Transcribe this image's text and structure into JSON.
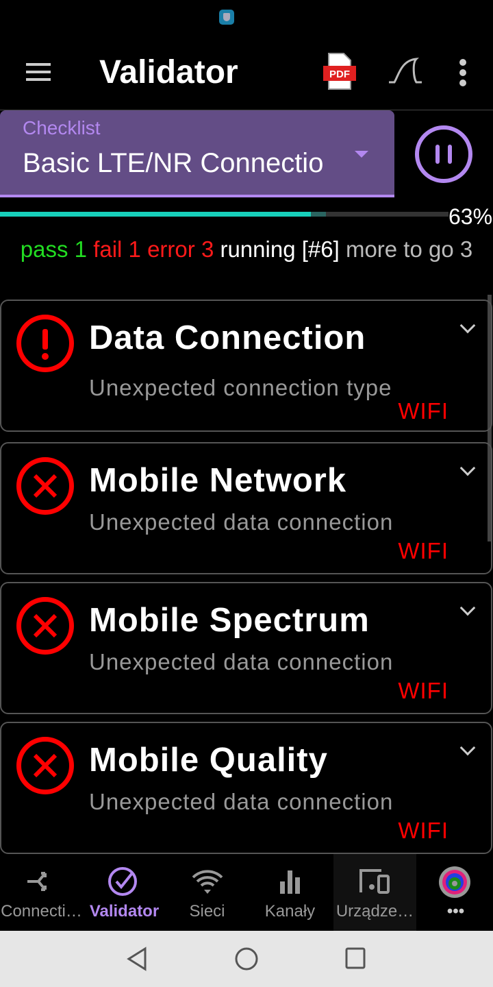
{
  "app": {
    "title": "Validator"
  },
  "checklist": {
    "label": "Checklist",
    "value": "Basic LTE/NR Connectio"
  },
  "progress": {
    "percent": 63,
    "percent_label": "63%"
  },
  "summary": {
    "pass_label": "pass",
    "pass": "1",
    "fail_label": "fail",
    "fail": "1",
    "error_label": "error",
    "error": "3",
    "running": "running [#6]",
    "more": "more to go 3"
  },
  "cards": [
    {
      "title": "Data Connection",
      "desc": "Unexpected connection type",
      "value": "WIFI",
      "status": "error"
    },
    {
      "title": "Mobile Network",
      "desc": "Unexpected data connection",
      "value": "WIFI",
      "status": "fail"
    },
    {
      "title": "Mobile Spectrum",
      "desc": "Unexpected data connection",
      "value": "WIFI",
      "status": "fail"
    },
    {
      "title": "Mobile Quality",
      "desc": "Unexpected data connection",
      "value": "WIFI",
      "status": "fail"
    }
  ],
  "tabs": [
    {
      "label": "Connecti…"
    },
    {
      "label": "Validator"
    },
    {
      "label": "Sieci"
    },
    {
      "label": "Kanały"
    },
    {
      "label": "Urządze…"
    },
    {
      "label": "•••"
    }
  ],
  "colors": {
    "accent": "#b388f0",
    "pass": "#22dd22",
    "fail": "#ff1a1a",
    "progress": "#17d0bb"
  }
}
